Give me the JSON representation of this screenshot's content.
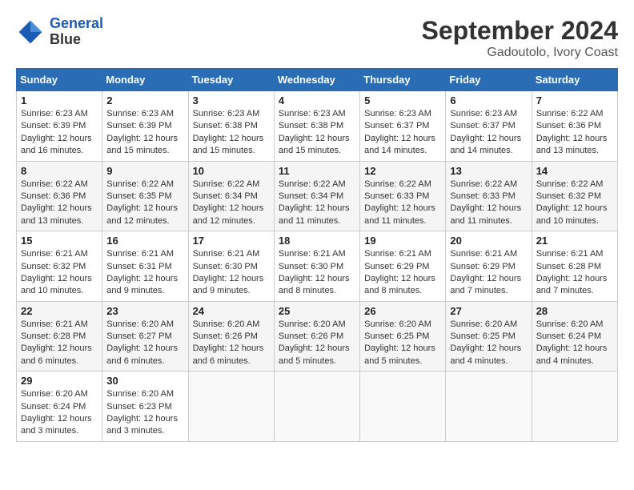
{
  "header": {
    "logo_line1": "General",
    "logo_line2": "Blue",
    "month_title": "September 2024",
    "location": "Gadoutolo, Ivory Coast"
  },
  "weekdays": [
    "Sunday",
    "Monday",
    "Tuesday",
    "Wednesday",
    "Thursday",
    "Friday",
    "Saturday"
  ],
  "weeks": [
    [
      {
        "day": "1",
        "sunrise": "6:23 AM",
        "sunset": "6:39 PM",
        "daylight": "12 hours and 16 minutes."
      },
      {
        "day": "2",
        "sunrise": "6:23 AM",
        "sunset": "6:39 PM",
        "daylight": "12 hours and 15 minutes."
      },
      {
        "day": "3",
        "sunrise": "6:23 AM",
        "sunset": "6:38 PM",
        "daylight": "12 hours and 15 minutes."
      },
      {
        "day": "4",
        "sunrise": "6:23 AM",
        "sunset": "6:38 PM",
        "daylight": "12 hours and 15 minutes."
      },
      {
        "day": "5",
        "sunrise": "6:23 AM",
        "sunset": "6:37 PM",
        "daylight": "12 hours and 14 minutes."
      },
      {
        "day": "6",
        "sunrise": "6:23 AM",
        "sunset": "6:37 PM",
        "daylight": "12 hours and 14 minutes."
      },
      {
        "day": "7",
        "sunrise": "6:22 AM",
        "sunset": "6:36 PM",
        "daylight": "12 hours and 13 minutes."
      }
    ],
    [
      {
        "day": "8",
        "sunrise": "6:22 AM",
        "sunset": "6:36 PM",
        "daylight": "12 hours and 13 minutes."
      },
      {
        "day": "9",
        "sunrise": "6:22 AM",
        "sunset": "6:35 PM",
        "daylight": "12 hours and 12 minutes."
      },
      {
        "day": "10",
        "sunrise": "6:22 AM",
        "sunset": "6:34 PM",
        "daylight": "12 hours and 12 minutes."
      },
      {
        "day": "11",
        "sunrise": "6:22 AM",
        "sunset": "6:34 PM",
        "daylight": "12 hours and 11 minutes."
      },
      {
        "day": "12",
        "sunrise": "6:22 AM",
        "sunset": "6:33 PM",
        "daylight": "12 hours and 11 minutes."
      },
      {
        "day": "13",
        "sunrise": "6:22 AM",
        "sunset": "6:33 PM",
        "daylight": "12 hours and 11 minutes."
      },
      {
        "day": "14",
        "sunrise": "6:22 AM",
        "sunset": "6:32 PM",
        "daylight": "12 hours and 10 minutes."
      }
    ],
    [
      {
        "day": "15",
        "sunrise": "6:21 AM",
        "sunset": "6:32 PM",
        "daylight": "12 hours and 10 minutes."
      },
      {
        "day": "16",
        "sunrise": "6:21 AM",
        "sunset": "6:31 PM",
        "daylight": "12 hours and 9 minutes."
      },
      {
        "day": "17",
        "sunrise": "6:21 AM",
        "sunset": "6:30 PM",
        "daylight": "12 hours and 9 minutes."
      },
      {
        "day": "18",
        "sunrise": "6:21 AM",
        "sunset": "6:30 PM",
        "daylight": "12 hours and 8 minutes."
      },
      {
        "day": "19",
        "sunrise": "6:21 AM",
        "sunset": "6:29 PM",
        "daylight": "12 hours and 8 minutes."
      },
      {
        "day": "20",
        "sunrise": "6:21 AM",
        "sunset": "6:29 PM",
        "daylight": "12 hours and 7 minutes."
      },
      {
        "day": "21",
        "sunrise": "6:21 AM",
        "sunset": "6:28 PM",
        "daylight": "12 hours and 7 minutes."
      }
    ],
    [
      {
        "day": "22",
        "sunrise": "6:21 AM",
        "sunset": "6:28 PM",
        "daylight": "12 hours and 6 minutes."
      },
      {
        "day": "23",
        "sunrise": "6:20 AM",
        "sunset": "6:27 PM",
        "daylight": "12 hours and 6 minutes."
      },
      {
        "day": "24",
        "sunrise": "6:20 AM",
        "sunset": "6:26 PM",
        "daylight": "12 hours and 6 minutes."
      },
      {
        "day": "25",
        "sunrise": "6:20 AM",
        "sunset": "6:26 PM",
        "daylight": "12 hours and 5 minutes."
      },
      {
        "day": "26",
        "sunrise": "6:20 AM",
        "sunset": "6:25 PM",
        "daylight": "12 hours and 5 minutes."
      },
      {
        "day": "27",
        "sunrise": "6:20 AM",
        "sunset": "6:25 PM",
        "daylight": "12 hours and 4 minutes."
      },
      {
        "day": "28",
        "sunrise": "6:20 AM",
        "sunset": "6:24 PM",
        "daylight": "12 hours and 4 minutes."
      }
    ],
    [
      {
        "day": "29",
        "sunrise": "6:20 AM",
        "sunset": "6:24 PM",
        "daylight": "12 hours and 3 minutes."
      },
      {
        "day": "30",
        "sunrise": "6:20 AM",
        "sunset": "6:23 PM",
        "daylight": "12 hours and 3 minutes."
      },
      null,
      null,
      null,
      null,
      null
    ]
  ]
}
